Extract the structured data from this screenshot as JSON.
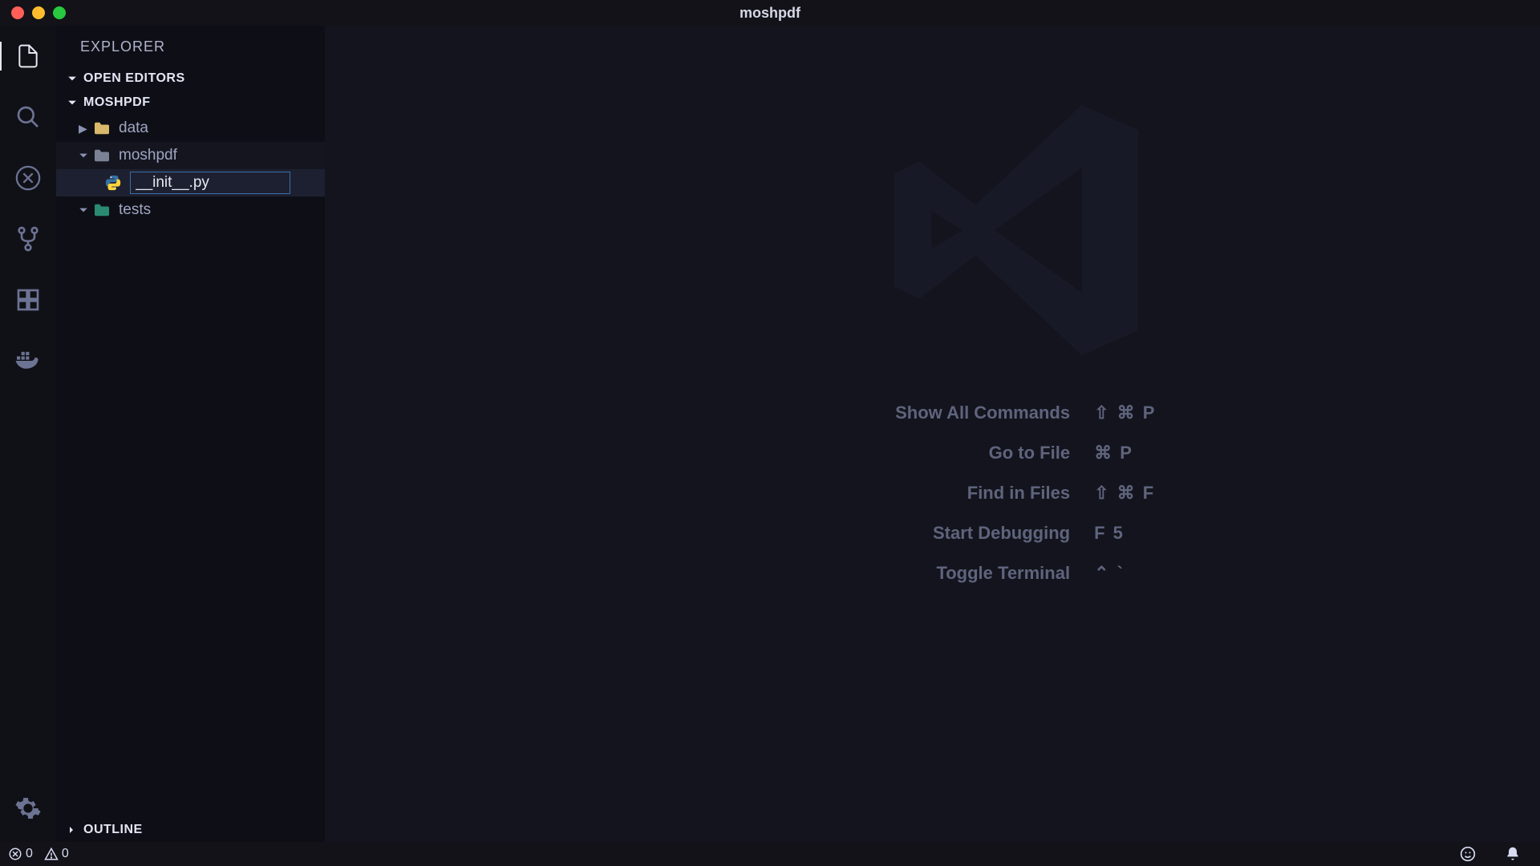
{
  "window": {
    "title": "moshpdf"
  },
  "sidebar": {
    "title": "EXPLORER",
    "sections": {
      "openEditors": "Open Editors",
      "workspace": "moshpdf",
      "outline": "Outline"
    },
    "tree": {
      "data": "data",
      "moshpdf": "moshpdf",
      "tests": "tests",
      "renamingFile": "__init__.py"
    }
  },
  "welcome": {
    "shortcuts": [
      {
        "label": "Show All Commands",
        "keys": "⇧ ⌘ P"
      },
      {
        "label": "Go to File",
        "keys": "⌘ P"
      },
      {
        "label": "Find in Files",
        "keys": "⇧ ⌘ F"
      },
      {
        "label": "Start Debugging",
        "keys": "F 5"
      },
      {
        "label": "Toggle Terminal",
        "keys": "⌃ `"
      }
    ]
  },
  "statusbar": {
    "errors": "0",
    "warnings": "0"
  }
}
